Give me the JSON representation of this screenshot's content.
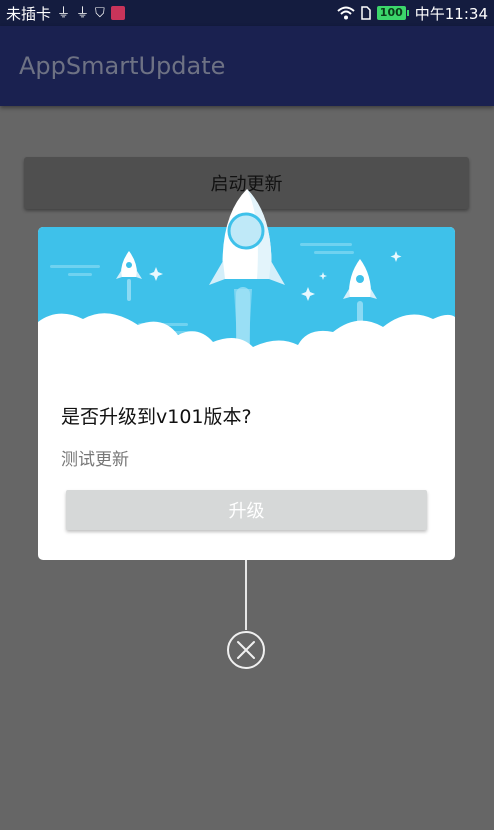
{
  "status_bar": {
    "carrier": "未插卡",
    "battery": "100",
    "time": "中午11:34",
    "icons": [
      "usb-icon",
      "usb-icon",
      "shield-icon",
      "notification-badge-icon",
      "wifi-icon",
      "sim-icon",
      "battery-icon"
    ]
  },
  "app_bar": {
    "title": "AppSmartUpdate"
  },
  "main": {
    "start_update_label": "启动更新"
  },
  "dialog": {
    "title": "是否升级到v101版本?",
    "message": "测试更新",
    "upgrade_label": "升级",
    "header_color": "#3ec1ea"
  },
  "colors": {
    "status_bar": "#141c3f",
    "app_bar": "#1a2150",
    "overlay": "#666666",
    "dialog_header": "#3ec1ea"
  }
}
